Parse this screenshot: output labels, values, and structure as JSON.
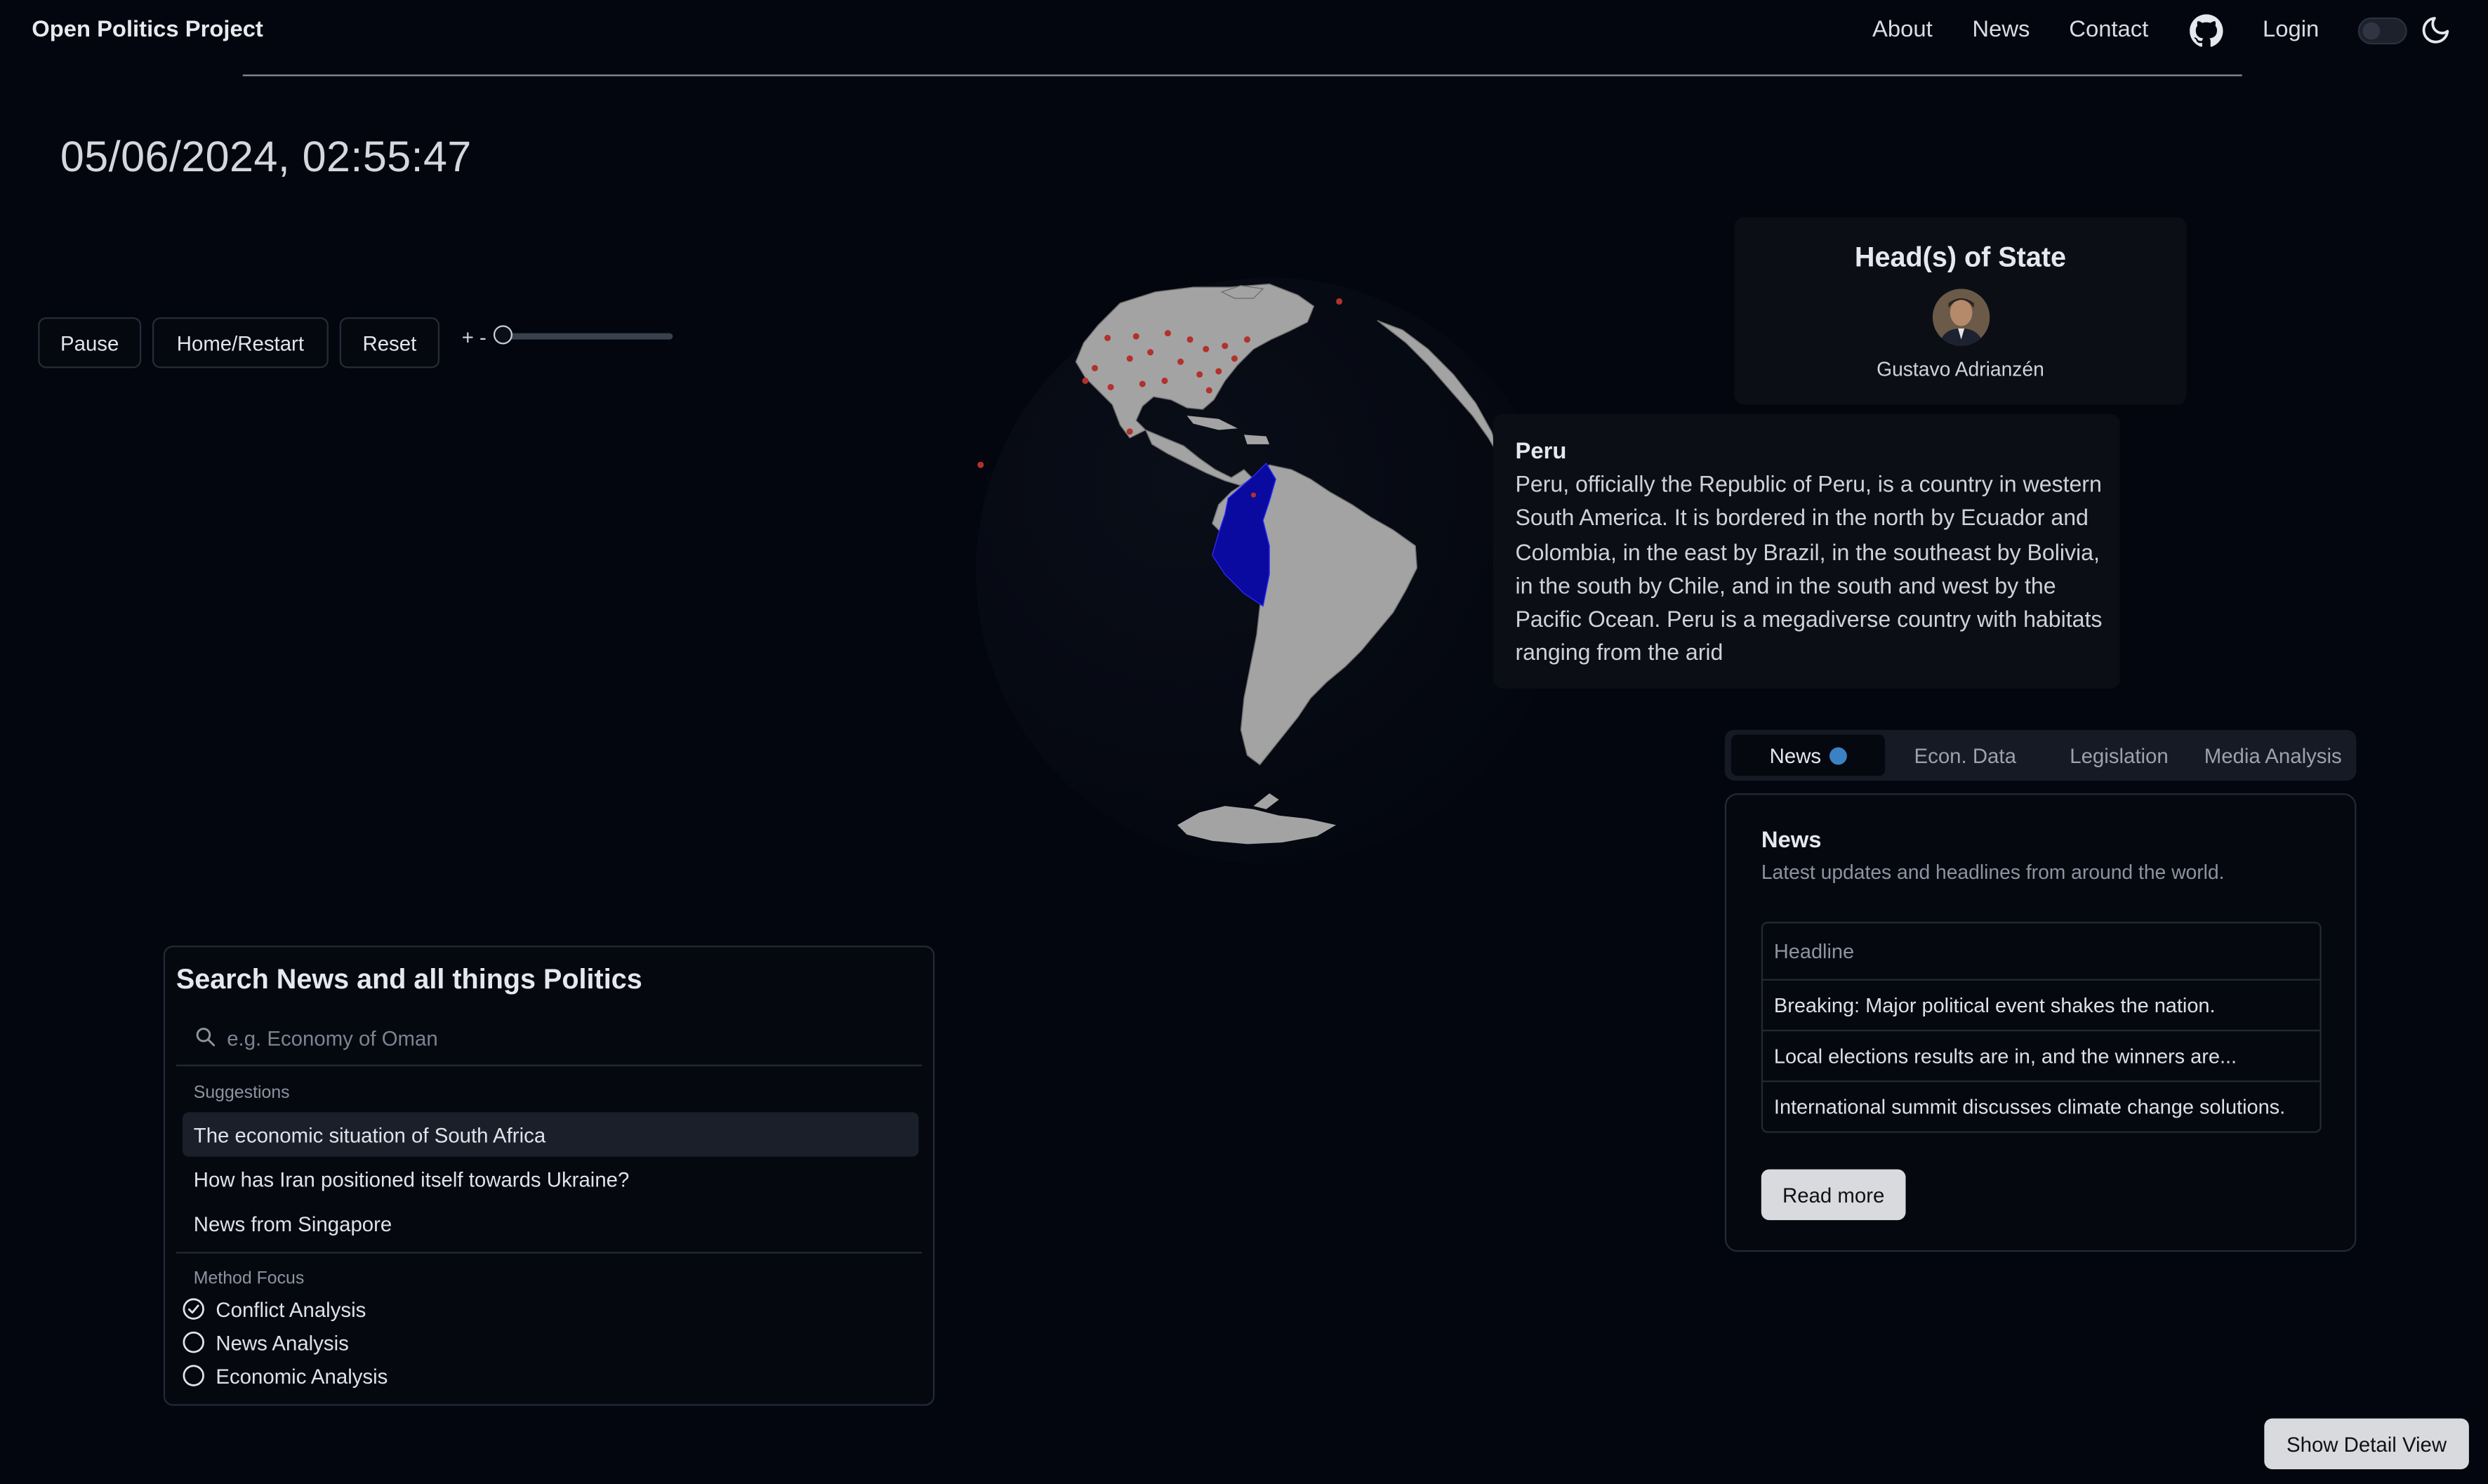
{
  "header": {
    "brand": "Open Politics Project",
    "nav": [
      "About",
      "News",
      "Contact"
    ],
    "login": "Login",
    "icons": [
      "github-icon",
      "moon-icon"
    ]
  },
  "datetime": "05/06/2024, 02:55:47",
  "controls": {
    "pause": "Pause",
    "home": "Home/Restart",
    "reset": "Reset",
    "zoom_label": "+ -",
    "zoom_level": 0.0
  },
  "head_of_state": {
    "title": "Head(s) of State",
    "name": "Gustavo Adrianzén"
  },
  "country": {
    "name": "Peru",
    "description": "Peru, officially the Republic of Peru, is a country in western South America. It is bordered in the north by Ecuador and Colombia, in the east by Brazil, in the southeast by Bolivia, in the south by Chile, and in the south and west by the Pacific Ocean. Peru is a megadiverse country with habitats ranging from the arid"
  },
  "tabs": [
    "News",
    "Econ. Data",
    "Legislation",
    "Media Analysis"
  ],
  "news": {
    "title": "News",
    "subtitle": "Latest updates and headlines from around the world.",
    "column": "Headline",
    "rows": [
      "Breaking: Major political event shakes the nation.",
      "Local elections results are in, and the winners are...",
      "International summit discusses climate change solutions."
    ],
    "read_more": "Read more"
  },
  "search": {
    "title": "Search News and all things Politics",
    "placeholder": "e.g. Economy of Oman",
    "suggestions_label": "Suggestions",
    "suggestions": [
      "The economic situation of South Africa",
      "How has Iran positioned itself towards Ukraine?",
      "News from Singapore"
    ],
    "method_label": "Method Focus",
    "methods": [
      {
        "label": "Conflict Analysis",
        "checked": true
      },
      {
        "label": "News Analysis",
        "checked": false
      },
      {
        "label": "Economic Analysis",
        "checked": false
      }
    ]
  },
  "detail_view": "Show Detail View",
  "colors": {
    "background": "#03060e",
    "highlight_country": "#0a0aa0",
    "land": "#a3a3a3",
    "event_dot": "#b3312b",
    "tab_dot": "#3b82c4"
  }
}
